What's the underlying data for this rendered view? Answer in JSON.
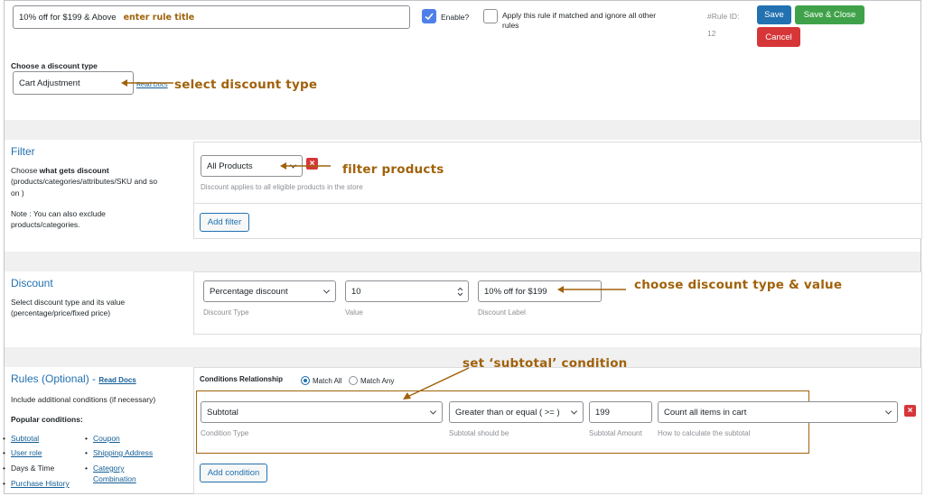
{
  "header": {
    "rule_title_value": "10% off for $199 & Above",
    "enable_label": "Enable?",
    "apply_rule_label_line1": "Apply this rule if matched and ignore all other",
    "apply_rule_label_line2": "rules",
    "rule_id_label": "#Rule ID:",
    "rule_id_value": "12",
    "save_label": "Save",
    "save_close_label": "Save & Close",
    "cancel_label": "Cancel"
  },
  "discount_type": {
    "label": "Choose a discount type",
    "value": "Cart Adjustment",
    "read_docs": "Read Docs"
  },
  "filter": {
    "title": "Filter",
    "desc_prefix": "Choose ",
    "desc_bold": "what gets discount",
    "desc_line2": "(products/categories/attributes/SKU and so",
    "desc_line3": "on )",
    "note_line1": "Note : You can also exclude",
    "note_line2": "products/categories.",
    "select_value": "All Products",
    "help_text": "Discount applies to all eligible products in the store",
    "add_filter_label": "Add filter"
  },
  "discount": {
    "title": "Discount",
    "desc_line1": "Select discount type and its value",
    "desc_line2": "(percentage/price/fixed price)",
    "type_value": "Percentage discount",
    "type_caption": "Discount Type",
    "value": "10",
    "value_caption": "Value",
    "label_value": "10% off for $199",
    "label_caption": "Discount Label"
  },
  "rules": {
    "title": "Rules (Optional)",
    "dash": " - ",
    "read_docs": "Read Docs",
    "desc": "Include additional conditions (if necessary)",
    "popular_label": "Popular conditions:",
    "popular": {
      "subtotal": "Subtotal",
      "coupon": "Coupon",
      "user_role": "User role",
      "shipping_address": "Shipping Address",
      "days_time": "Days & Time",
      "category_line1": "Category",
      "category_line2": "Combination",
      "purchase_history": "Purchase History"
    },
    "conditions_relationship_label": "Conditions Relationship",
    "match_all_label": "Match All",
    "match_any_label": "Match Any",
    "condition_type_value": "Subtotal",
    "condition_type_caption": "Condition Type",
    "operator_value": "Greater than or equal ( >= )",
    "operator_caption": "Subtotal should be",
    "amount_value": "199",
    "amount_caption": "Subtotal Amount",
    "calc_value": "Count all items in cart",
    "calc_caption": "How to calculate the subtotal",
    "add_condition_label": "Add condition"
  },
  "annotations": {
    "enter_rule_title": "enter rule title",
    "select_discount_type": "select discount type",
    "filter_products": "filter products",
    "choose_discount": "choose discount type & value",
    "set_subtotal": "set ‘subtotal’ condition"
  },
  "colors": {
    "accent": "#2271b1",
    "annotation": "#a0620a",
    "save_close": "#3fa24a",
    "danger": "#d63638"
  }
}
